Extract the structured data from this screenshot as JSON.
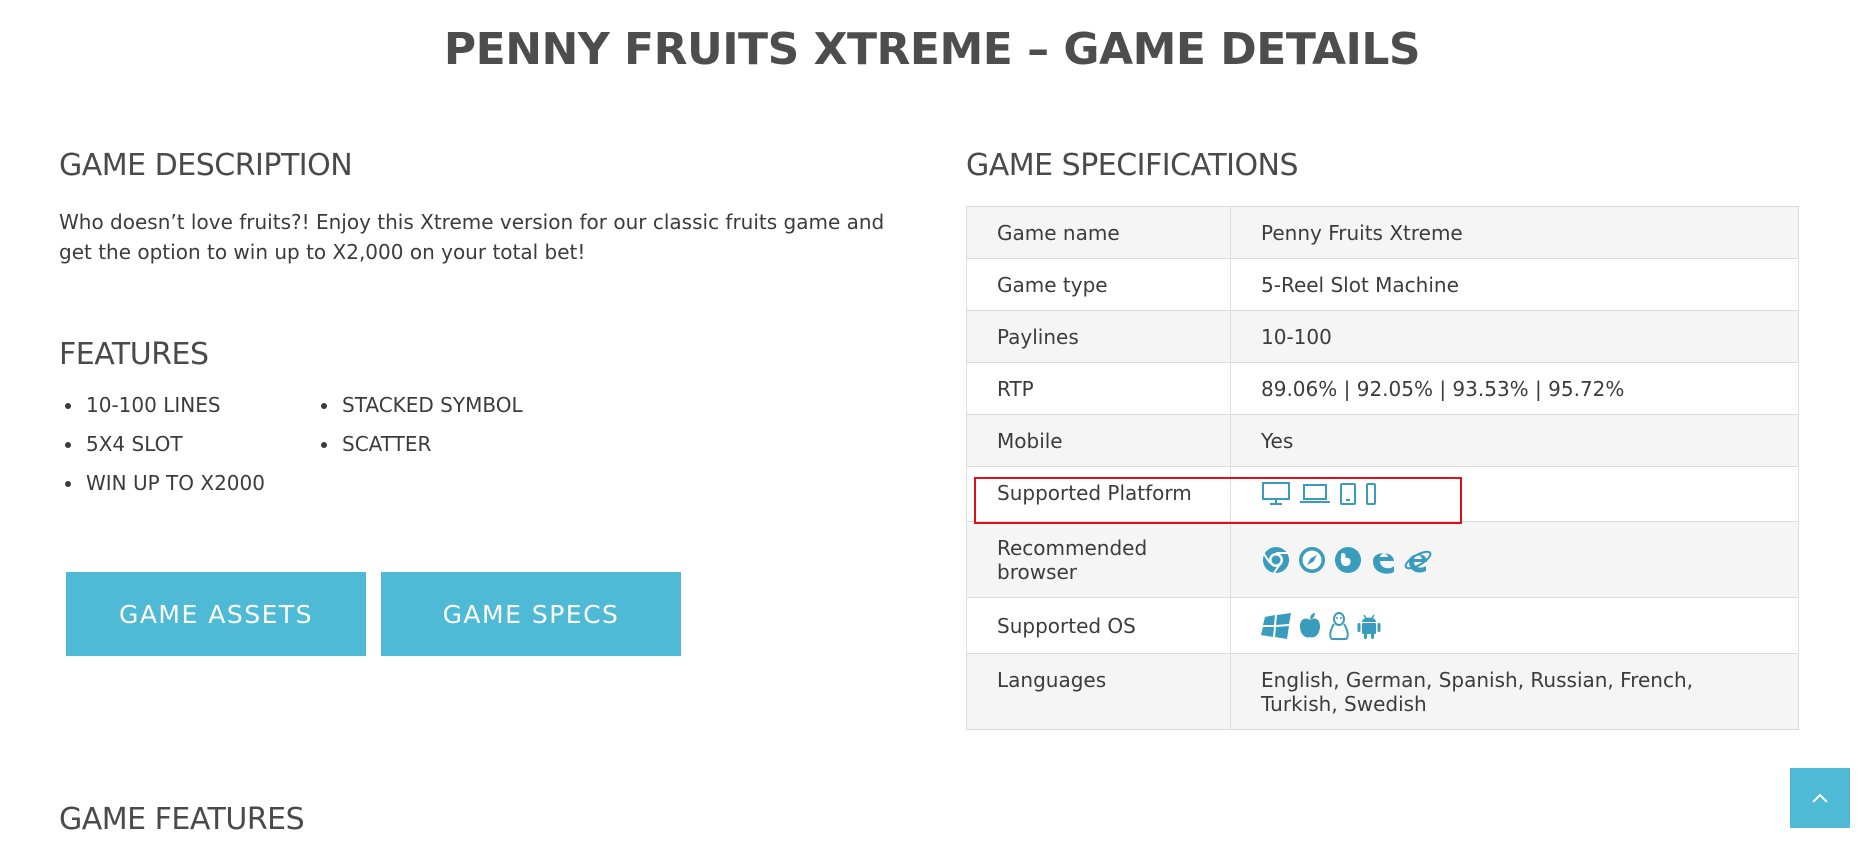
{
  "page_title": "PENNY FRUITS XTREME – GAME DETAILS",
  "description": {
    "heading": "GAME DESCRIPTION",
    "text": "Who doesn’t love fruits?! Enjoy this Xtreme version for our classic fruits game and get the option to win up to X2,000 on your total bet!"
  },
  "features": {
    "heading": "FEATURES",
    "items": [
      "10-100 LINES",
      "5X4 SLOT",
      "WIN UP TO X2000",
      "STACKED SYMBOL",
      "SCATTER"
    ]
  },
  "buttons": {
    "assets": "GAME ASSETS",
    "specs": "GAME SPECS"
  },
  "specs": {
    "heading": "GAME SPECIFICATIONS",
    "rows": [
      {
        "label": "Game name",
        "value": "Penny Fruits Xtreme"
      },
      {
        "label": "Game type",
        "value": "5-Reel Slot Machine"
      },
      {
        "label": "Paylines",
        "value": "10-100"
      },
      {
        "label": "RTP",
        "value": "89.06% | 92.05% | 93.53% | 95.72%"
      },
      {
        "label": "Mobile",
        "value": "Yes"
      },
      {
        "label": "Supported Platform",
        "icons": [
          "desktop-icon",
          "laptop-icon",
          "tablet-icon",
          "phone-icon"
        ]
      },
      {
        "label": "Recommended browser",
        "icons": [
          "chrome-icon",
          "safari-icon",
          "firefox-icon",
          "edge-icon",
          "internet-explorer-icon"
        ]
      },
      {
        "label": "Supported OS",
        "icons": [
          "windows-icon",
          "apple-icon",
          "linux-icon",
          "android-icon"
        ]
      },
      {
        "label": "Languages",
        "value": "English, German, Spanish, Russian, French, Turkish, Swedish"
      }
    ]
  },
  "game_features_heading": "GAME FEATURES",
  "colors": {
    "accent": "#4fbad6",
    "icon": "#3a9cbc",
    "highlight": "#e0101a",
    "heading": "#4a4a4a"
  }
}
